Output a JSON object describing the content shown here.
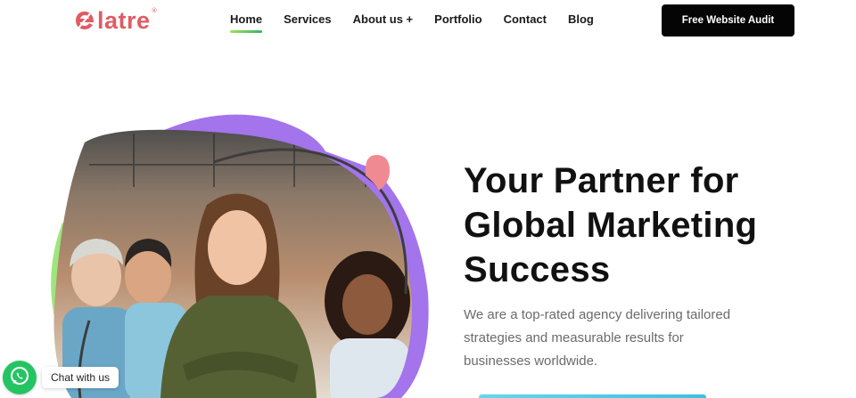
{
  "brand": {
    "logo_text": "latre",
    "logo_trademark": "®",
    "color": "#e15b64"
  },
  "nav": {
    "items": [
      {
        "label": "Home",
        "active": true
      },
      {
        "label": "Services"
      },
      {
        "label": "About us +"
      },
      {
        "label": "Portfolio"
      },
      {
        "label": "Contact"
      },
      {
        "label": "Blog"
      }
    ]
  },
  "header": {
    "cta_label": "Free Website Audit"
  },
  "hero": {
    "title_line1": "Your Partner for",
    "title_line2": "Global Marketing",
    "title_line3": "Success",
    "subtitle_line1": "We are a top-rated agency delivering tailored",
    "subtitle_line2": "strategies and measurable results for",
    "subtitle_line3": "businesses worldwide.",
    "accent_purple": "#a374ec",
    "accent_green": "#9ee57e",
    "accent_pink": "#ef8a93"
  },
  "chat": {
    "label": "Chat with us",
    "icon": "whatsapp-icon",
    "color": "#25c463"
  }
}
